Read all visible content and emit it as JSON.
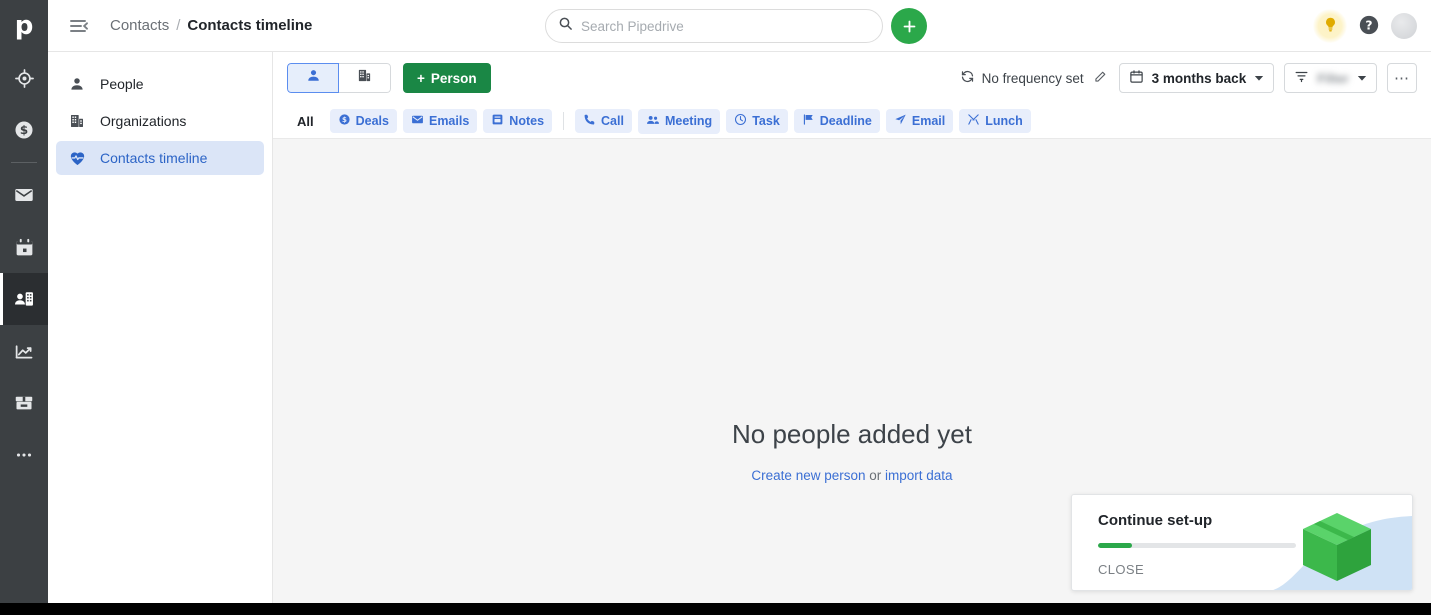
{
  "brand": {
    "logo_text": "p",
    "rail_bg": "#3c4043",
    "accent_green": "#2ba84a",
    "accent_blue": "#3b6fd4"
  },
  "rail": {
    "items": [
      {
        "name": "leads-icon",
        "label": "Leads"
      },
      {
        "name": "deals-icon",
        "label": "Deals"
      },
      {
        "name": "mail-icon",
        "label": "Mail"
      },
      {
        "name": "calendar-icon",
        "label": "Activities"
      },
      {
        "name": "contacts-icon",
        "label": "Contacts"
      },
      {
        "name": "insights-icon",
        "label": "Insights"
      },
      {
        "name": "products-icon",
        "label": "Products"
      },
      {
        "name": "more-icon",
        "label": "More"
      }
    ]
  },
  "header": {
    "collapse_icon": "collapse-sidebar-icon",
    "breadcrumb_parent": "Contacts",
    "breadcrumb_separator": "/",
    "breadcrumb_current": "Contacts timeline",
    "search": {
      "placeholder": "Search Pipedrive",
      "value": "",
      "icon": "search-icon"
    },
    "add_button_label": "+",
    "bulb_icon": "lightbulb-icon",
    "help_icon": "help-circle-icon",
    "avatar": "user-avatar"
  },
  "sidebar": {
    "items": [
      {
        "label": "People",
        "icon": "person-icon",
        "active": false
      },
      {
        "label": "Organizations",
        "icon": "organization-icon",
        "active": false
      },
      {
        "label": "Contacts timeline",
        "icon": "heart-pulse-icon",
        "active": true
      }
    ]
  },
  "toolbar": {
    "toggle_person_icon": "person-icon",
    "toggle_org_icon": "organization-icon",
    "add_person_label": "Person",
    "add_person_plus": "+",
    "frequency_label": "No frequency set",
    "frequency_icon": "sync-icon",
    "edit_icon": "pencil-icon",
    "date_range_label": "3 months back",
    "date_range_icon": "calendar-icon",
    "filter_label": "Filter",
    "filter_icon": "filter-icon",
    "more_label": "⋯"
  },
  "filters": {
    "all_label": "All",
    "group_one": [
      {
        "label": "Deals",
        "icon": "deal-dollar-icon"
      },
      {
        "label": "Emails",
        "icon": "envelope-icon"
      },
      {
        "label": "Notes",
        "icon": "note-icon"
      }
    ],
    "group_two": [
      {
        "label": "Call",
        "icon": "phone-icon"
      },
      {
        "label": "Meeting",
        "icon": "people-icon"
      },
      {
        "label": "Task",
        "icon": "clock-icon"
      },
      {
        "label": "Deadline",
        "icon": "flag-icon"
      },
      {
        "label": "Email",
        "icon": "send-icon"
      },
      {
        "label": "Lunch",
        "icon": "cutlery-icon"
      }
    ]
  },
  "empty_state": {
    "title": "No people added yet",
    "link_create": "Create new person",
    "or_text": " or ",
    "link_import": "import data"
  },
  "setup_card": {
    "title": "Continue set-up",
    "progress_percent": 17,
    "close_label": "CLOSE",
    "illustration": "green-box-icon"
  }
}
